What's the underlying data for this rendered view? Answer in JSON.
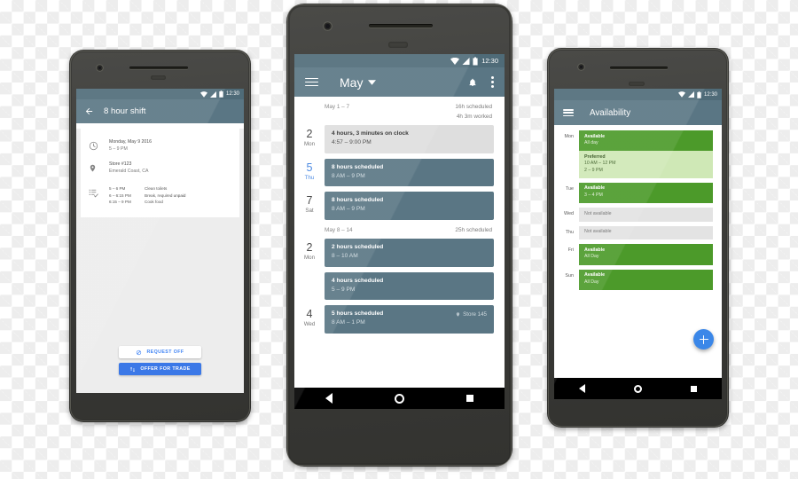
{
  "phones": {
    "left": {
      "status_bar": {
        "time": "12:30",
        "icons": [
          "wifi-icon",
          "signal-icon",
          "battery-icon"
        ]
      },
      "app_bar": {
        "back_icon": "back-arrow-icon",
        "title": "8 hour shift"
      },
      "details": [
        {
          "icon": "clock-icon",
          "line1": "Monday, May 9 2016",
          "line2": "5 – 9 PM"
        },
        {
          "icon": "location-pin-icon",
          "line1": "Store #123",
          "line2": "Emerald Coast, CA"
        }
      ],
      "tasks_icon": "task-list-icon",
      "tasks": [
        {
          "time": "5 – 6 PM",
          "label": "Clean toilets"
        },
        {
          "time": "6 – 6:15 PM",
          "label": "Break, required unpaid"
        },
        {
          "time": "6:15 – 9 PM",
          "label": "Cook food"
        }
      ],
      "actions": [
        {
          "icon": "request-off-icon",
          "label": "REQUEST OFF",
          "style": "flat"
        },
        {
          "icon": "trade-icon",
          "label": "OFFER FOR TRADE",
          "style": "filled"
        }
      ],
      "nav_bar": [
        "back-nav-icon",
        "home-nav-icon",
        "recents-nav-icon"
      ]
    },
    "center": {
      "status_bar": {
        "time": "12:30",
        "icons": [
          "wifi-icon",
          "signal-icon",
          "battery-icon"
        ]
      },
      "app_bar": {
        "menu_icon": "hamburger-menu-icon",
        "title": "May",
        "dropdown_icon": "chevron-down-icon",
        "notification_icon": "bell-icon",
        "overflow_icon": "kebab-menu-icon"
      },
      "weeks": [
        {
          "range": "May 1 – 7",
          "summary1": "16h scheduled",
          "summary2": "4h 3m worked",
          "days": [
            {
              "num": "2",
              "dow": "Mon",
              "today": false,
              "events": [
                {
                  "kind": "clock",
                  "title": "4 hours, 3 minutes on clock",
                  "time": "4:57 – 9:00 PM",
                  "location": ""
                }
              ]
            },
            {
              "num": "5",
              "dow": "Thu",
              "today": true,
              "events": [
                {
                  "kind": "sched",
                  "title": "8 hours scheduled",
                  "time": "8 AM – 9 PM",
                  "location": ""
                }
              ]
            },
            {
              "num": "7",
              "dow": "Sat",
              "today": false,
              "events": [
                {
                  "kind": "sched",
                  "title": "8 hours scheduled",
                  "time": "8 AM – 9 PM",
                  "location": ""
                }
              ]
            }
          ]
        },
        {
          "range": "May 8 – 14",
          "summary1": "25h scheduled",
          "summary2": "",
          "days": [
            {
              "num": "2",
              "dow": "Mon",
              "today": false,
              "events": [
                {
                  "kind": "sched",
                  "title": "2 hours scheduled",
                  "time": "8 – 10 AM",
                  "location": ""
                },
                {
                  "kind": "sched",
                  "title": "4 hours scheduled",
                  "time": "5 – 9 PM",
                  "location": ""
                }
              ]
            },
            {
              "num": "4",
              "dow": "Wed",
              "today": false,
              "events": [
                {
                  "kind": "sched",
                  "title": "5 hours scheduled",
                  "time": "8 AM – 1 PM",
                  "location": "Store 145"
                }
              ]
            }
          ]
        }
      ],
      "nav_bar": [
        "back-nav-icon",
        "home-nav-icon",
        "recents-nav-icon"
      ]
    },
    "right": {
      "status_bar": {
        "time": "12:30",
        "icons": [
          "wifi-icon",
          "signal-icon",
          "battery-icon"
        ]
      },
      "app_bar": {
        "menu_icon": "hamburger-menu-icon",
        "title": "Availability"
      },
      "days": [
        {
          "label": "Mon",
          "blocks": [
            {
              "kind": "avail",
              "title": "Available",
              "lines": [
                "All day"
              ]
            },
            {
              "kind": "pref",
              "title": "Preferred",
              "lines": [
                "10 AM – 12 PM",
                "2 – 9 PM"
              ]
            }
          ]
        },
        {
          "label": "Tue",
          "blocks": [
            {
              "kind": "avail",
              "title": "Available",
              "lines": [
                "3 – 4 PM"
              ]
            }
          ]
        },
        {
          "label": "Wed",
          "blocks": [
            {
              "kind": "none",
              "title": "Not available",
              "lines": []
            }
          ]
        },
        {
          "label": "Thu",
          "blocks": [
            {
              "kind": "none",
              "title": "Not available",
              "lines": []
            }
          ]
        },
        {
          "label": "Fri",
          "blocks": [
            {
              "kind": "avail",
              "title": "Available",
              "lines": [
                "All Day"
              ]
            }
          ]
        },
        {
          "label": "Sun",
          "blocks": [
            {
              "kind": "avail",
              "title": "Available",
              "lines": [
                "All Day"
              ]
            }
          ]
        }
      ],
      "fab": {
        "icon": "add-icon"
      },
      "nav_bar": [
        "back-nav-icon",
        "home-nav-icon",
        "recents-nav-icon"
      ]
    }
  },
  "colors": {
    "status_bar": "#4f6b78",
    "app_bar": "#5a7684",
    "event_scheduled": "#5a7684",
    "event_clock": "#dedede",
    "available": "#4c9a2a",
    "preferred": "#cfe8b6",
    "not_available": "#e3e3e3",
    "fab": "#3b87e8",
    "accent_blue": "#3b78e7"
  }
}
